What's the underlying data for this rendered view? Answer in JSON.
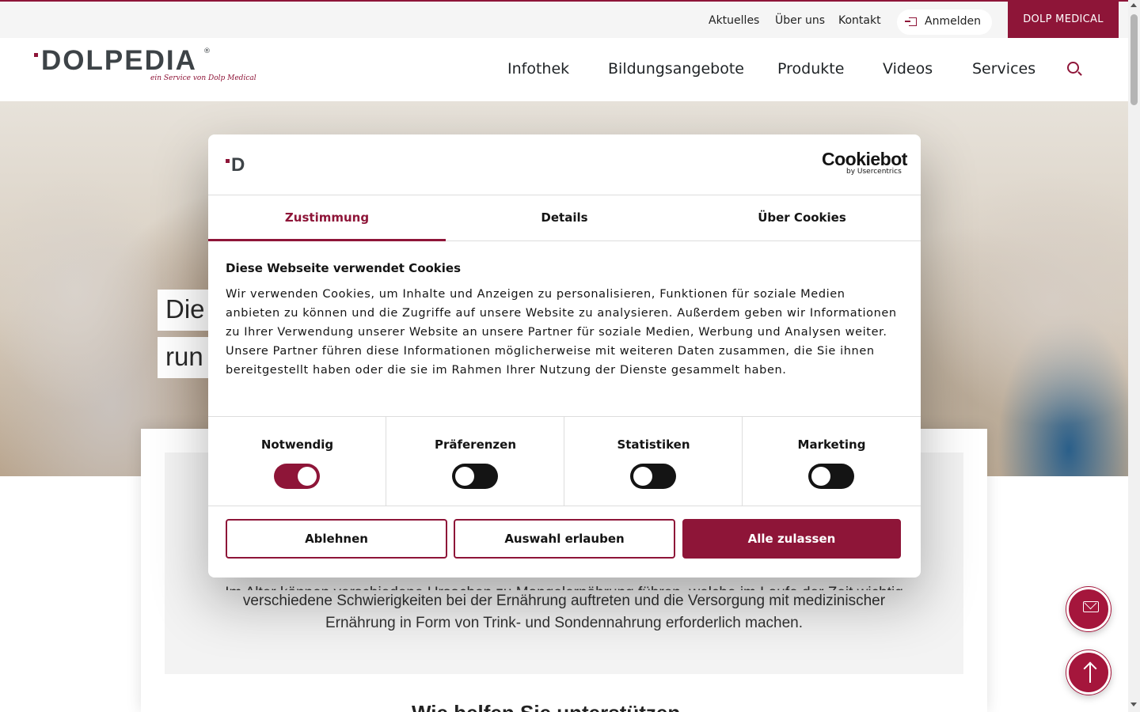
{
  "topbar": {
    "links": [
      "Aktuelles",
      "Über uns",
      "Kontakt"
    ],
    "login_label": "Anmelden",
    "brand_button": "DOLP MEDICAL"
  },
  "header": {
    "logo_text": "DOLPEDIA",
    "logo_reg": "®",
    "logo_tagline": "ein Service von Dolp Medical",
    "nav": [
      "Infothek",
      "Bildungsangebote",
      "Produkte",
      "Videos",
      "Services"
    ]
  },
  "hero": {
    "tag_line_1": "Die",
    "tag_line_2": "run"
  },
  "content": {
    "text_cut": "Im Alter können verschiedene Ursachen zu Mangelernährung führen, welche im Laufe der Zeit wichtig",
    "text_line_1": "verschiedene Schwierigkeiten bei der Ernährung auftreten und die Versorgung mit medizinischer",
    "text_line_2": "Ernährung in Form von Trink- und Sondennahrung erforderlich machen.",
    "heading_peek": "Wie helfen Sie unterstützen"
  },
  "cookie": {
    "logo_letter": "D",
    "brand": "Cookiebot",
    "brand_by": "by Usercentrics",
    "tabs": [
      "Zustimmung",
      "Details",
      "Über Cookies"
    ],
    "title": "Diese Webseite verwendet Cookies",
    "body": "Wir verwenden Cookies, um Inhalte und Anzeigen zu personalisieren, Funktionen für soziale Medien anbieten zu können und die Zugriffe auf unsere Website zu analysieren. Außerdem geben wir Informationen zu Ihrer Verwendung unserer Website an unsere Partner für soziale Medien, Werbung und Analysen weiter. Unsere Partner führen diese Informationen möglicherweise mit weiteren Daten zusammen, die Sie ihnen bereitgestellt haben oder die sie im Rahmen Ihrer Nutzung der Dienste gesammelt haben.",
    "toggles": [
      {
        "label": "Notwendig",
        "on": true
      },
      {
        "label": "Präferenzen",
        "on": false
      },
      {
        "label": "Statistiken",
        "on": false
      },
      {
        "label": "Marketing",
        "on": false
      }
    ],
    "buttons": {
      "decline": "Ablehnen",
      "allow_selection": "Auswahl erlauben",
      "allow_all": "Alle zulassen"
    }
  },
  "colors": {
    "brand": "#8e1538",
    "fab": "#a5163c",
    "toggle_off": "#141414"
  },
  "icons": [
    "login-icon",
    "search-icon",
    "contact-mail-icon",
    "arrow-up-icon"
  ]
}
